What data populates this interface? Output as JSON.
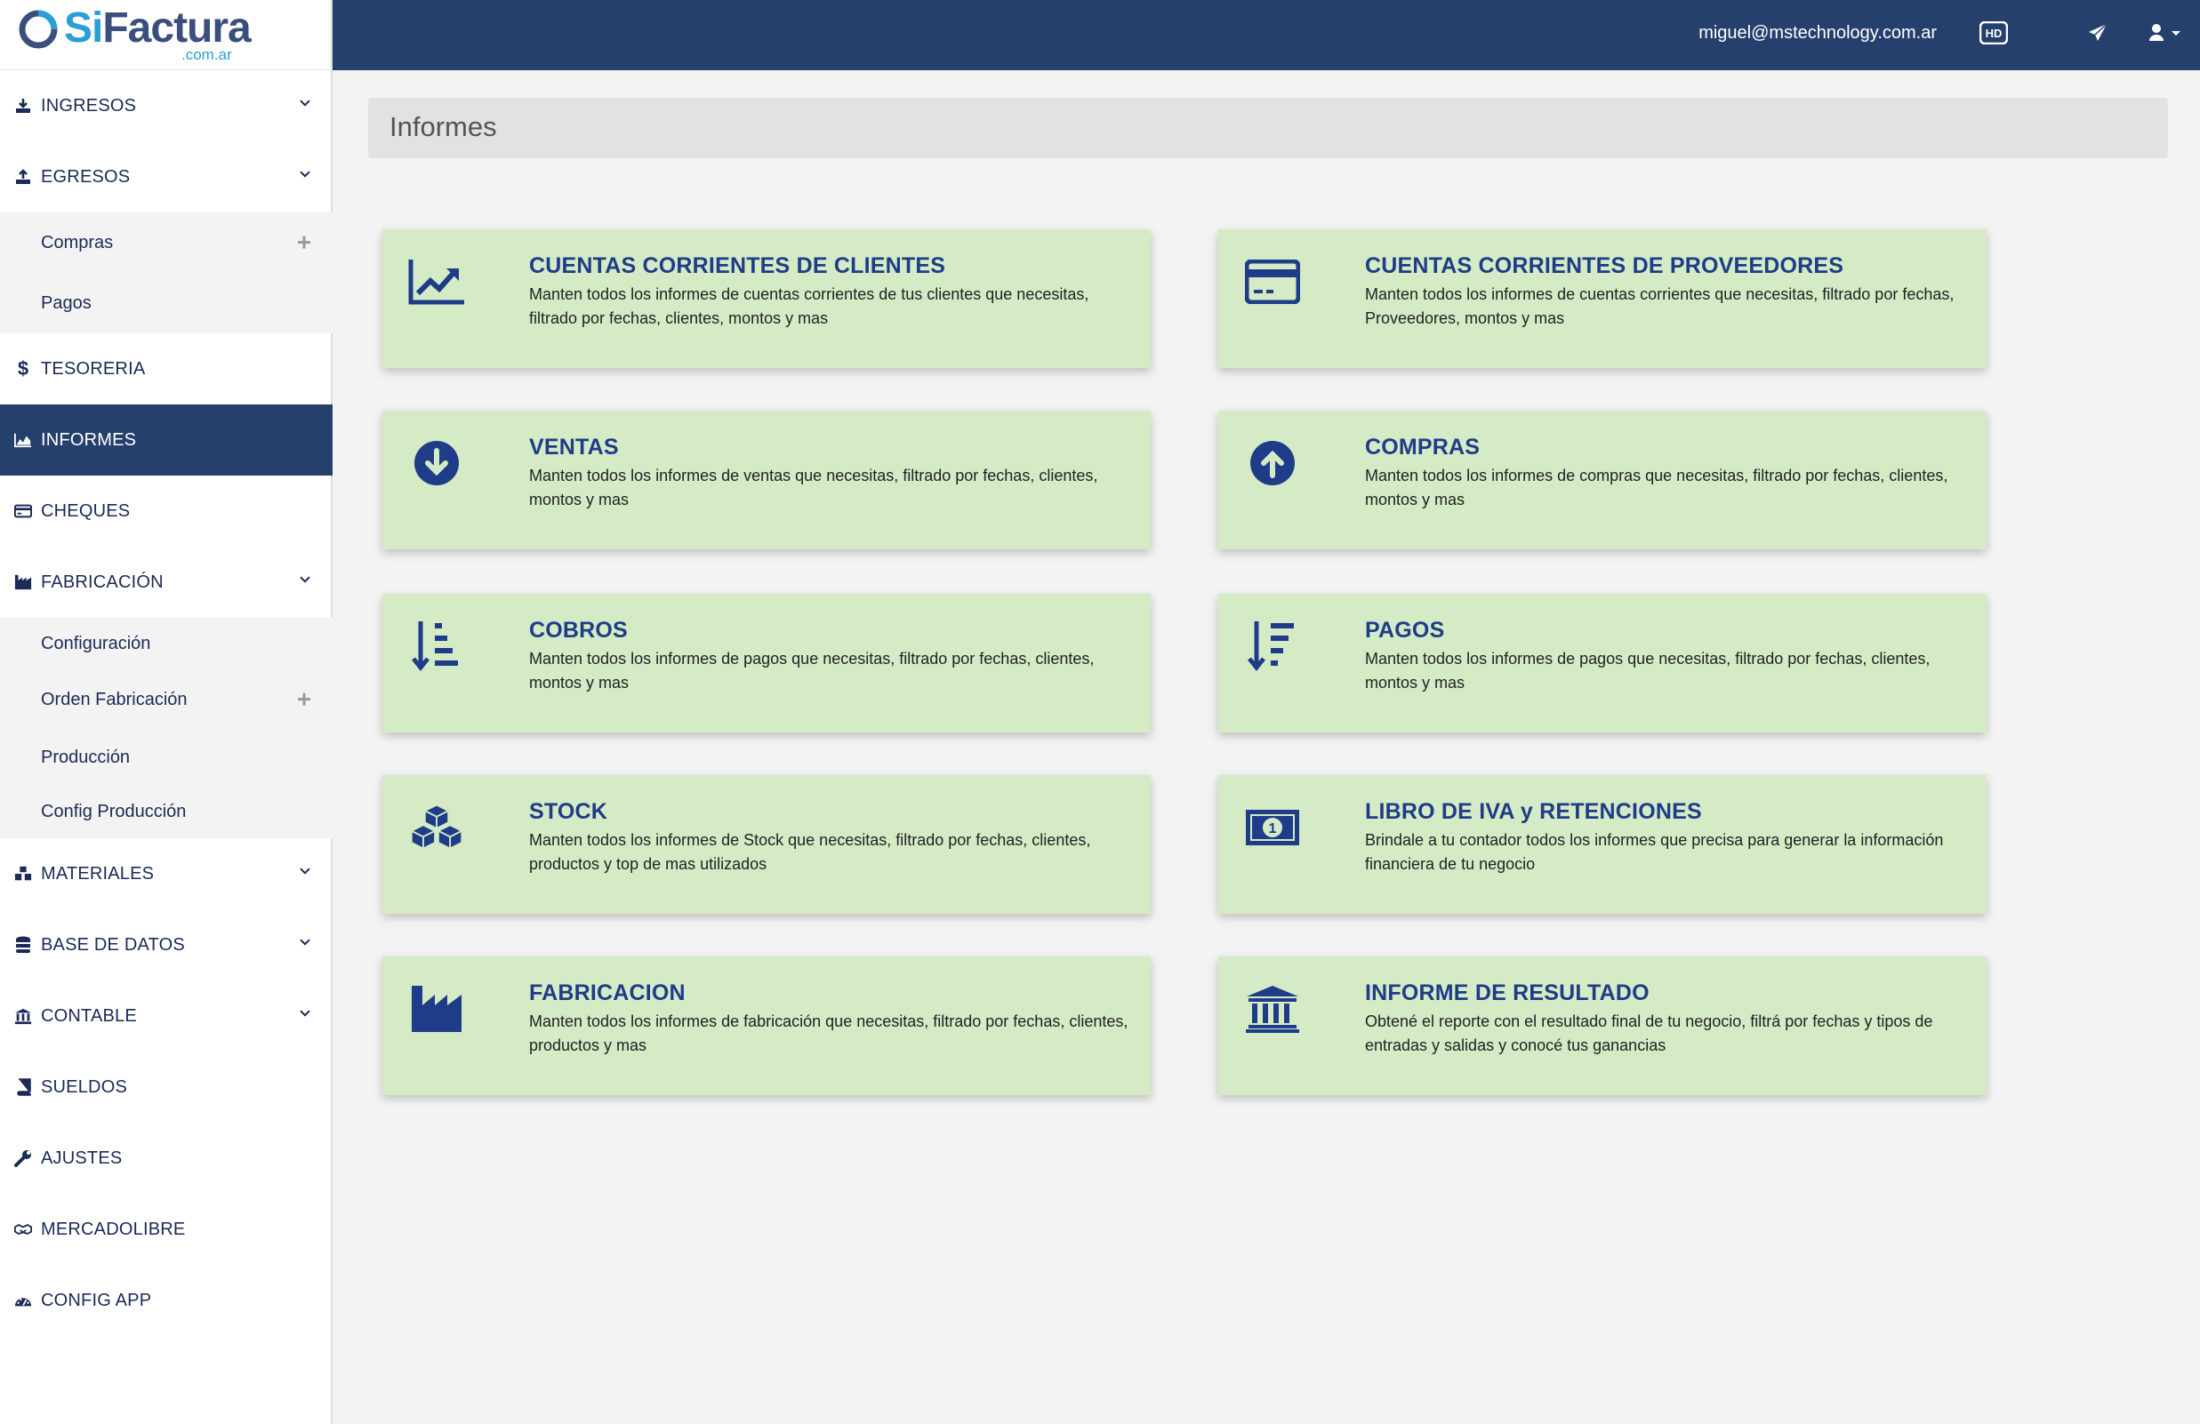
{
  "brand": {
    "name_si": "Si",
    "name_rest": "Factura",
    "domain": ".com.ar"
  },
  "topbar": {
    "user_email": "miguel@mstechnology.com.ar",
    "hd_badge": "HD"
  },
  "sidebar": {
    "items": [
      {
        "label": "INGRESOS"
      },
      {
        "label": "EGRESOS"
      },
      {
        "label": "TESORERIA"
      },
      {
        "label": "INFORMES"
      },
      {
        "label": "CHEQUES"
      },
      {
        "label": "FABRICACIÓN"
      },
      {
        "label": "MATERIALES"
      },
      {
        "label": "BASE DE DATOS"
      },
      {
        "label": "CONTABLE"
      },
      {
        "label": "SUELDOS"
      },
      {
        "label": "AJUSTES"
      },
      {
        "label": "MERCADOLIBRE"
      },
      {
        "label": "CONFIG APP"
      }
    ],
    "egresos_sub": [
      {
        "label": "Compras"
      },
      {
        "label": "Pagos"
      }
    ],
    "fabricacion_sub": [
      {
        "label": "Configuración"
      },
      {
        "label": "Orden Fabricación"
      },
      {
        "label": "Producción"
      },
      {
        "label": "Config Producción"
      }
    ]
  },
  "page": {
    "title": "Informes"
  },
  "colors": {
    "accent": "#26406d",
    "card": "#d4ebc6",
    "title": "#1f3c88"
  },
  "cards": [
    {
      "icon": "line-chart-icon",
      "title": "CUENTAS CORRIENTES DE CLIENTES",
      "desc": "Manten todos los informes de cuentas corrientes de tus clientes que necesitas, filtrado por fechas, clientes, montos y mas"
    },
    {
      "icon": "credit-card-icon",
      "title": "CUENTAS CORRIENTES DE PROVEEDORES",
      "desc": "Manten todos los informes de cuentas corrientes que necesitas, filtrado por fechas, Proveedores, montos y mas"
    },
    {
      "icon": "arrow-down-circle-icon",
      "title": "VENTAS",
      "desc": "Manten todos los informes de ventas que necesitas, filtrado por fechas, clientes, montos y mas"
    },
    {
      "icon": "arrow-up-circle-icon",
      "title": "COMPRAS",
      "desc": "Manten todos los informes de compras que necesitas, filtrado por fechas, clientes, montos y mas"
    },
    {
      "icon": "sort-amount-down-icon",
      "title": "COBROS",
      "desc": "Manten todos los informes de pagos que necesitas, filtrado por fechas, clientes, montos y mas"
    },
    {
      "icon": "sort-amount-desc-icon",
      "title": "PAGOS",
      "desc": "Manten todos los informes de pagos que necesitas, filtrado por fechas, clientes, montos y mas"
    },
    {
      "icon": "cubes-icon",
      "title": "STOCK",
      "desc": "Manten todos los informes de Stock que necesitas, filtrado por fechas, clientes, productos y top de mas utilizados"
    },
    {
      "icon": "money-bill-icon",
      "title": "LIBRO DE IVA y RETENCIONES",
      "desc": "Brindale a tu contador todos los informes que precisa para generar la información financiera de tu negocio"
    },
    {
      "icon": "industry-icon",
      "title": "FABRICACION",
      "desc": "Manten todos los informes de fabricación que necesitas, filtrado por fechas, clientes, productos y mas"
    },
    {
      "icon": "bank-icon",
      "title": "INFORME DE RESULTADO",
      "desc": "Obtené el reporte con el resultado final de tu negocio, filtrá por fechas y tipos de entradas y salidas y conocé tus ganancias"
    }
  ]
}
